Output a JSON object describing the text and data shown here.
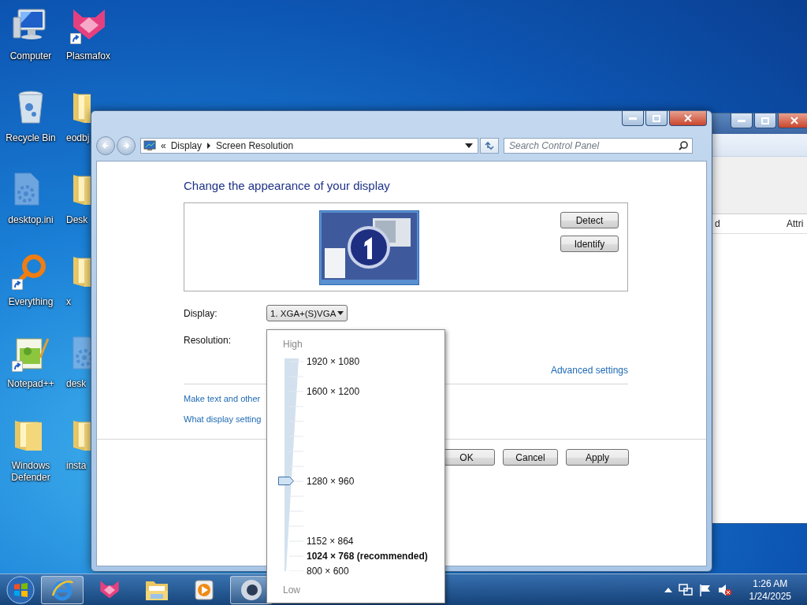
{
  "desktop": {
    "column_1": [
      {
        "label": "Computer",
        "kind": "computer",
        "shortcut": false
      },
      {
        "label": "Recycle Bin",
        "kind": "recycle",
        "shortcut": false
      },
      {
        "label": "desktop.ini",
        "kind": "settings-file",
        "shortcut": false
      },
      {
        "label": "Everything",
        "kind": "search-app",
        "shortcut": true
      },
      {
        "label": "Notepad++",
        "kind": "notepad",
        "shortcut": true
      },
      {
        "label": "Windows Defender",
        "kind": "folder",
        "shortcut": false
      }
    ],
    "column_2": [
      {
        "label": "Plasmafox",
        "kind": "fox",
        "shortcut": true
      },
      {
        "label": "eodbj",
        "kind": "folder",
        "shortcut": false
      },
      {
        "label": "Desk",
        "kind": "folder",
        "shortcut": false
      },
      {
        "label": "x",
        "kind": "folder",
        "shortcut": false
      },
      {
        "label": "desk",
        "kind": "settings-file",
        "shortcut": false
      },
      {
        "label": "insta",
        "kind": "folder",
        "shortcut": false
      }
    ]
  },
  "background_window": {
    "columns": [
      "d",
      "Attri"
    ]
  },
  "window": {
    "address": {
      "overflow": "«",
      "breadcrumbs": [
        "Display",
        "Screen Resolution"
      ]
    },
    "search": {
      "placeholder": "Search Control Panel"
    },
    "heading": "Change the appearance of your display",
    "monitor_buttons": [
      "Detect",
      "Identify"
    ],
    "display": {
      "label": "Display:",
      "value": "1. XGA+(S)VGA"
    },
    "resolution": {
      "label": "Resolution:"
    },
    "advanced_link": "Advanced settings",
    "links": [
      "Make text and other",
      "What display setting"
    ],
    "buttons": [
      "OK",
      "Cancel",
      "Apply"
    ]
  },
  "resolution_popup": {
    "high_label": "High",
    "low_label": "Low",
    "level": 0.429,
    "options": [
      {
        "label": "1920 × 1080",
        "recommended": false
      },
      {
        "label": "1600 × 1200",
        "recommended": false
      },
      {
        "label": "1280 × 960",
        "recommended": false
      },
      {
        "label": "1152 × 864",
        "recommended": false
      },
      {
        "label": "1024 × 768 (recommended)",
        "recommended": true
      },
      {
        "label": "800 × 600",
        "recommended": false
      }
    ]
  },
  "taskbar": {
    "apps": [
      {
        "kind": "browser",
        "running": true
      },
      {
        "kind": "fox",
        "running": false
      },
      {
        "kind": "explorer",
        "running": false
      },
      {
        "kind": "media",
        "running": false
      },
      {
        "kind": "eye",
        "running": true
      }
    ],
    "clock": {
      "time": "1:26 AM",
      "date": "1/24/2025"
    }
  }
}
